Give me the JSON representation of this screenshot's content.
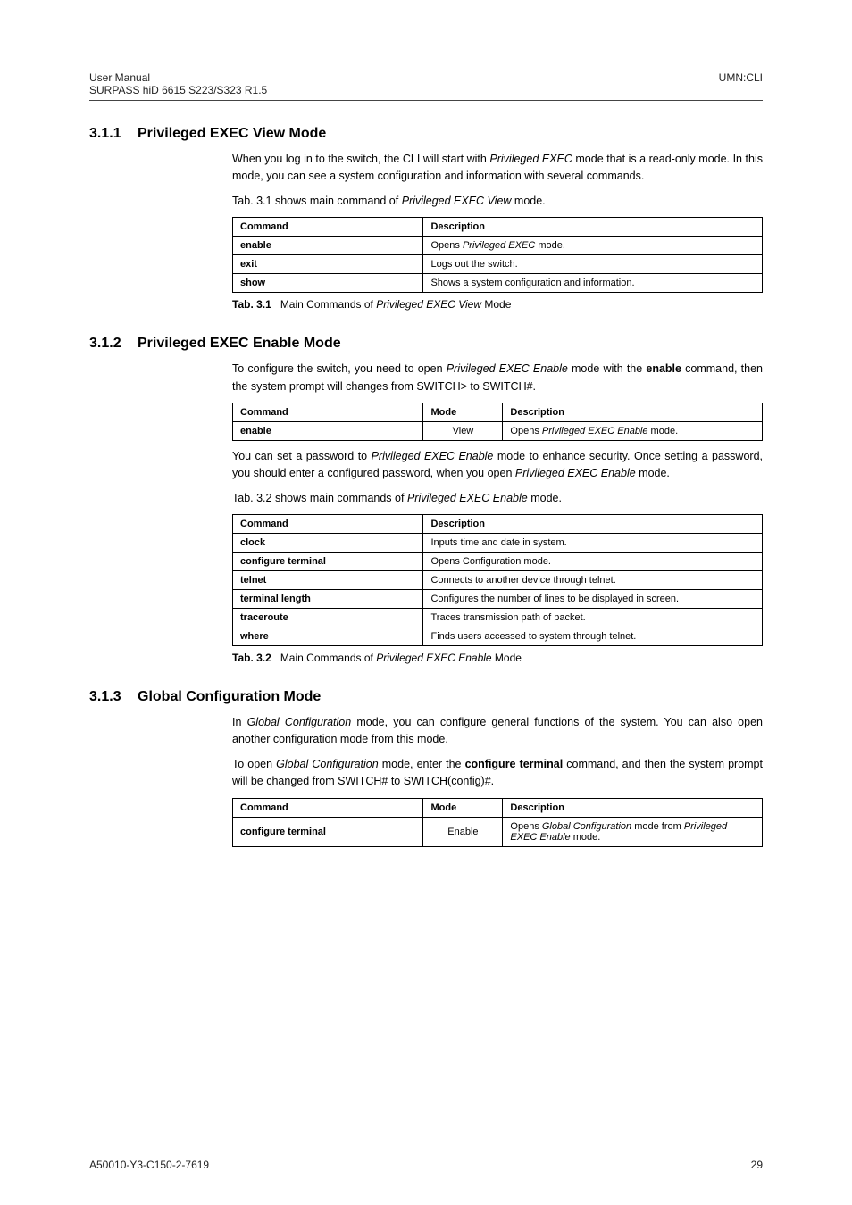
{
  "header": {
    "leftTop": "User Manual",
    "leftBottom": "SURPASS hiD 6615 S223/S323 R1.5",
    "right": "UMN:CLI"
  },
  "s1": {
    "num": "3.1.1",
    "title": "Privileged EXEC View Mode",
    "p1a": "When you log in to the switch, the CLI will start with ",
    "p1b": "Privileged EXEC",
    "p1c": " mode that is a read-only mode. In this mode, you can see a system configuration and information with several commands.",
    "p2a": "Tab. 3.1 shows main command of ",
    "p2b": "Privileged EXEC View",
    "p2c": " mode.",
    "th1": "Command",
    "th2": "Description",
    "r1c1": "enable",
    "r1c2a": "Opens ",
    "r1c2b": "Privileged EXEC",
    "r1c2c": " mode.",
    "r2c1": "exit",
    "r2c2": "Logs out the switch.",
    "r3c1": "show",
    "r3c2": "Shows a system configuration and information.",
    "capA": "Tab. 3.1",
    "capB": "Main Commands of ",
    "capC": "Privileged EXEC View",
    "capD": " Mode"
  },
  "s2": {
    "num": "3.1.2",
    "title": "Privileged EXEC Enable Mode",
    "p1a": "To configure the switch, you need to open ",
    "p1b": "Privileged EXEC Enable",
    "p1c": " mode with the ",
    "p1d": "enable",
    "p1e": " command, then the system prompt will changes from SWITCH> to SWITCH#.",
    "th1": "Command",
    "th2": "Mode",
    "th3": "Description",
    "r1c1": "enable",
    "r1c2": "View",
    "r1c3a": "Opens ",
    "r1c3b": "Privileged EXEC Enable",
    "r1c3c": " mode.",
    "p2a": "You can set a password to ",
    "p2b": "Privileged EXEC Enable",
    "p2c": " mode to enhance security. Once setting a password, you should enter a configured password, when you open ",
    "p2d": "Privileged EXEC Enable",
    "p2e": " mode.",
    "p3a": "Tab. 3.2 shows main commands of ",
    "p3b": "Privileged EXEC Enable",
    "p3c": " mode.",
    "t2th1": "Command",
    "t2th2": "Description",
    "t2r1c1": "clock",
    "t2r1c2": "Inputs time and date in system.",
    "t2r2c1": "configure terminal",
    "t2r2c2": "Opens Configuration mode.",
    "t2r3c1": "telnet",
    "t2r3c2": "Connects to another device through telnet.",
    "t2r4c1": "terminal length",
    "t2r4c2": "Configures the number of lines to be displayed in screen.",
    "t2r5c1": "traceroute",
    "t2r5c2": "Traces transmission path of packet.",
    "t2r6c1": "where",
    "t2r6c2": "Finds users accessed to system through telnet.",
    "capA": "Tab. 3.2",
    "capB": "Main Commands of ",
    "capC": "Privileged EXEC Enable",
    "capD": " Mode"
  },
  "s3": {
    "num": "3.1.3",
    "title": "Global Configuration Mode",
    "p1a": "In ",
    "p1b": "Global Configuration",
    "p1c": " mode, you can configure general functions of the system. You can also open another configuration mode from this mode.",
    "p2a": "To open ",
    "p2b": "Global Configuration",
    "p2c": " mode, enter the ",
    "p2d": "configure terminal",
    "p2e": " command, and then the system prompt will be changed from SWITCH# to SWITCH(config)#.",
    "th1": "Command",
    "th2": "Mode",
    "th3": "Description",
    "r1c1": "configure terminal",
    "r1c2": "Enable",
    "r1c3a": "Opens ",
    "r1c3b": "Global Configuration",
    "r1c3c": " mode from ",
    "r1c3d": "Privileged EXEC Enable",
    "r1c3e": " mode."
  },
  "footer": {
    "left": "A50010-Y3-C150-2-7619",
    "right": "29"
  }
}
